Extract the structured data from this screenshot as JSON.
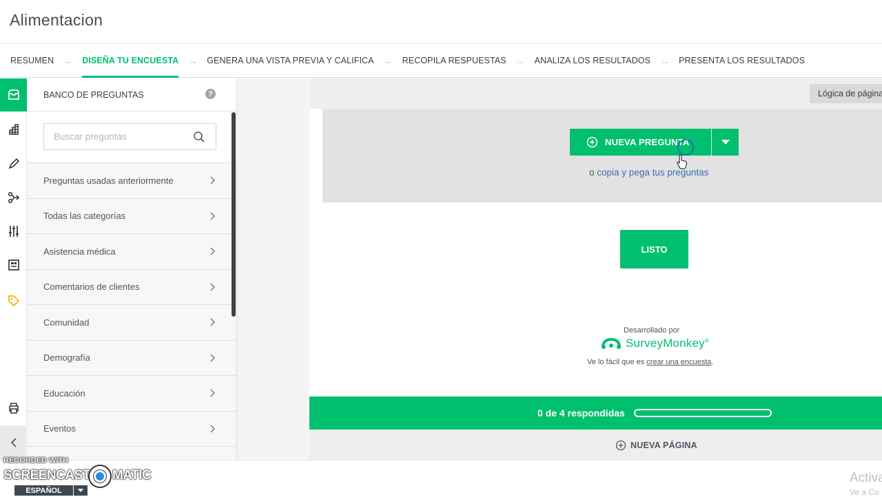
{
  "app": {
    "title": "Alimentacion"
  },
  "steps": [
    {
      "label": "RESUMEN",
      "active": false
    },
    {
      "label": "DISEÑA TU ENCUESTA",
      "active": true
    },
    {
      "label": "GENERA UNA VISTA PREVIA Y CALIFICA",
      "active": false
    },
    {
      "label": "RECOPILA RESPUESTAS",
      "active": false
    },
    {
      "label": "ANALIZA LOS RESULTADOS",
      "active": false
    },
    {
      "label": "PRESENTA LOS RESULTADOS",
      "active": false
    }
  ],
  "rail": {
    "icons": [
      "question-bank-icon",
      "themes-icon",
      "edit-icon",
      "logic-icon",
      "options-icon",
      "layout-icon",
      "tag-icon",
      "print-icon",
      "collapse-icon"
    ],
    "accent": "#00bf6f"
  },
  "bank": {
    "title": "BANCO DE PREGUNTAS",
    "help": "?",
    "search_placeholder": "Buscar preguntas",
    "categories": [
      "Preguntas usadas anteriormente",
      "Todas las categorías",
      "Asistencia médica",
      "Comentarios de clientes",
      "Comunidad",
      "Demografía",
      "Educación",
      "Eventos"
    ]
  },
  "canvas": {
    "logic_tab": "Lógica de página",
    "new_question": "NUEVA PREGUNTA",
    "copy_prefix": "o",
    "copy_link": "copia y pega tus preguntas",
    "done_button": "LISTO",
    "powered_by": "Desarrollado por",
    "brand": "SurveyMonkey",
    "brand_mark": "®",
    "easy_prefix": "Ve lo fácil que es",
    "easy_link": "crear una encuesta",
    "easy_suffix": ".",
    "progress_label": "0 de 4 respondidas",
    "progress_fraction": 0,
    "new_page": "NUEVA PÁGINA"
  },
  "overlay": {
    "recorded_with": "RECORDED WITH",
    "screencast_left": "SCREENCAST",
    "screencast_right": "MATIC",
    "language": "ESPAÑOL",
    "activate_title": "Activa",
    "activate_sub": "Ve a Co"
  },
  "colors": {
    "accent": "#00bf6f",
    "link": "#3a6fa8",
    "text": "#333e48"
  }
}
